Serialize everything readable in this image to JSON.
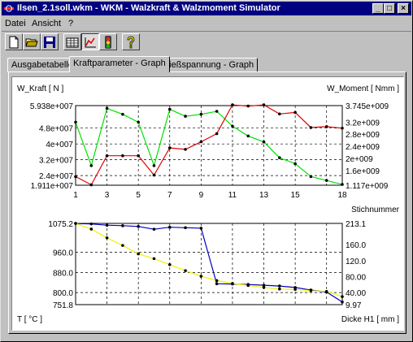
{
  "window": {
    "title": "Ilsen_2.1soll.wkm - WKM - Walzkraft & Walzmoment Simulator",
    "controls": {
      "minimize": "_",
      "maximize": "□",
      "close": "×"
    }
  },
  "menu": [
    {
      "label": "Datei"
    },
    {
      "label": "Ansicht"
    },
    {
      "label": "?"
    }
  ],
  "toolbar": {
    "buttons": [
      {
        "icon": "new-document-icon"
      },
      {
        "icon": "open-folder-icon"
      },
      {
        "icon": "save-disk-icon"
      },
      {
        "icon": "table-view-icon"
      },
      {
        "icon": "graph-view-icon",
        "pressed": true
      },
      {
        "icon": "traffic-light-icon"
      },
      {
        "icon": "help-icon"
      }
    ]
  },
  "tabs": [
    {
      "label": "Ausgabetabelle",
      "active": false
    },
    {
      "label": "Kraftparameter - Graph",
      "active": true
    },
    {
      "label": "Fließspannung - Graph",
      "active": false
    }
  ],
  "chart_data": [
    {
      "type": "line",
      "xlabel": "Stichnummer",
      "x": [
        1,
        2,
        3,
        4,
        5,
        6,
        7,
        8,
        9,
        10,
        11,
        12,
        13,
        14,
        15,
        16,
        17,
        18
      ],
      "x_ticks": [
        "1",
        "3",
        "5",
        "7",
        "9",
        "11",
        "13",
        "15",
        "18"
      ],
      "left_axis": {
        "label": "W_Kraft [ N ]",
        "ylim": [
          19110000,
          59380000
        ],
        "tick_labels": [
          "5.938e+007",
          "4.8e+007",
          "4e+007",
          "3.2e+007",
          "2.4e+007",
          "1.911e+007"
        ],
        "tick_values": [
          59380000,
          48000000,
          40000000,
          32000000,
          24000000,
          19110000
        ]
      },
      "right_axis": {
        "label": "W_Moment [ Nmm ]",
        "ylim": [
          1117000000.0,
          3745000000.0
        ],
        "tick_labels": [
          "3.745e+009",
          "3.2e+009",
          "2.8e+009",
          "2.4e+009",
          "2e+009",
          "1.6e+009",
          "1.117e+009"
        ],
        "tick_values": [
          3745000000.0,
          3200000000.0,
          2800000000.0,
          2400000000.0,
          2000000000.0,
          1600000000.0,
          1117000000.0
        ]
      },
      "grid": true,
      "series": [
        {
          "color": "#00e000",
          "axis": "left",
          "values": [
            51000000,
            29000000,
            58000000,
            55000000,
            51000000,
            29000000,
            57500000,
            54000000,
            55000000,
            56500000,
            49000000,
            44000000,
            41000000,
            33000000,
            30000000,
            23500000,
            21500000,
            19500000
          ]
        },
        {
          "color": "#e00000",
          "axis": "right",
          "values": [
            1400000000.0,
            1130000000.0,
            2090000000.0,
            2090000000.0,
            2090000000.0,
            1450000000.0,
            2350000000.0,
            2300000000.0,
            2550000000.0,
            2820000000.0,
            3770000000.0,
            3730000000.0,
            3770000000.0,
            3470000000.0,
            3520000000.0,
            3020000000.0,
            3050000000.0,
            3000000000.0
          ]
        }
      ]
    },
    {
      "type": "line",
      "x": [
        1,
        2,
        3,
        4,
        5,
        6,
        7,
        8,
        9,
        10,
        11,
        12,
        13,
        14,
        15,
        16,
        17,
        18
      ],
      "left_axis": {
        "label": "T [ °C ]",
        "ylim": [
          751.8,
          1075.2
        ],
        "tick_labels": [
          "1075.2",
          "960.0",
          "880.0",
          "800.0",
          "751.8"
        ],
        "tick_values": [
          1075.2,
          960.0,
          880.0,
          800.0,
          751.8
        ]
      },
      "right_axis": {
        "label": "Dicke H1 [ mm ]",
        "ylim": [
          9.97,
          213.1
        ],
        "tick_labels": [
          "213.1",
          "160.0",
          "120.0",
          "80.00",
          "40.00",
          "9.97"
        ],
        "tick_values": [
          213.1,
          160.0,
          120.0,
          80.0,
          40.0,
          9.97
        ]
      },
      "grid": true,
      "series": [
        {
          "color": "#0000c0",
          "axis": "left",
          "values": [
            1075,
            1073,
            1068,
            1066,
            1063,
            1052,
            1060,
            1058,
            1056,
            835,
            834,
            832,
            829,
            826,
            820,
            810,
            802,
            762
          ]
        },
        {
          "color": "#f0f000",
          "axis": "right",
          "values": [
            213.1,
            199,
            177,
            158,
            137,
            125,
            110,
            95,
            81,
            70,
            63,
            58,
            53,
            49,
            48,
            45,
            43,
            30
          ]
        }
      ]
    }
  ]
}
